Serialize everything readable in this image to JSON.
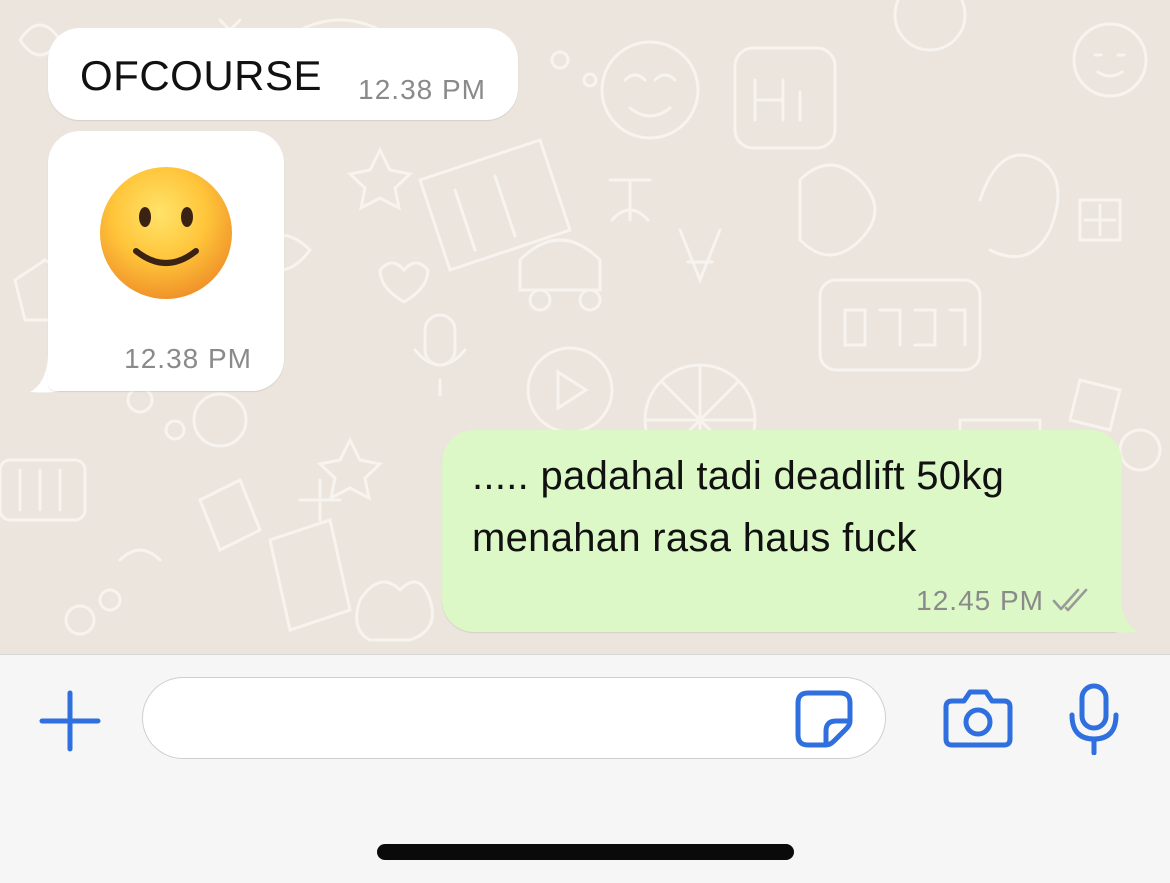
{
  "theme": {
    "chat_background": "#ece5dd",
    "incoming_bubble": "#ffffff",
    "outgoing_bubble": "#dcf8c6",
    "accent": "#2f6fde",
    "timestamp": "#8a8a8a"
  },
  "messages": [
    {
      "direction": "incoming",
      "text": "OFCOURSE",
      "time": "12.38 PM"
    },
    {
      "direction": "incoming",
      "emoji": "slightly-smiling-face-emoji",
      "time": "12.38 PM"
    },
    {
      "direction": "outgoing",
      "lines": [
        "..... padahal tadi deadlift 50kg",
        "menahan rasa haus fuck"
      ],
      "time": "12.45 PM",
      "status_icon": "double-check-icon"
    }
  ],
  "composer": {
    "value": "",
    "icons": {
      "attach": "plus-icon",
      "sticker": "sticker-icon",
      "camera": "camera-icon",
      "voice": "microphone-icon"
    }
  }
}
